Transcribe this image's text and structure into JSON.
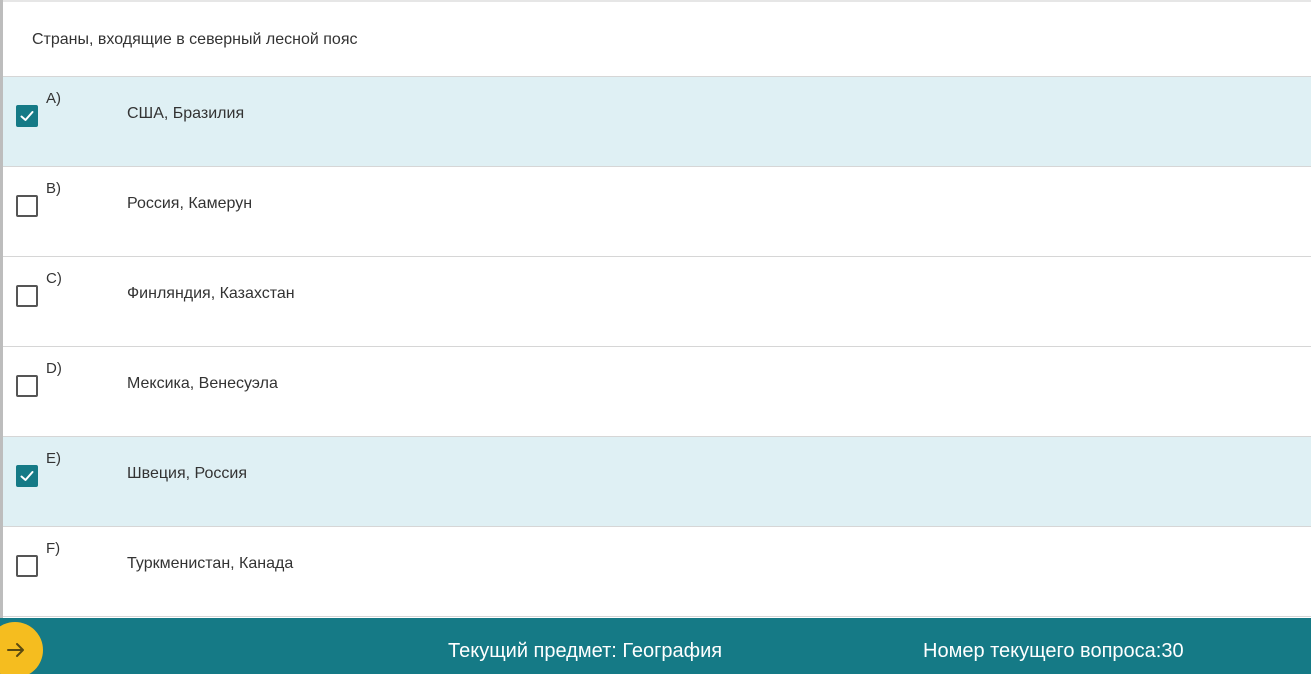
{
  "question": {
    "text": "Страны, входящие в северный лесной пояс"
  },
  "answers": [
    {
      "letter": "A)",
      "text": "США, Бразилия",
      "checked": true
    },
    {
      "letter": "B)",
      "text": "Россия, Камерун",
      "checked": false
    },
    {
      "letter": "C)",
      "text": "Финляндия, Казахстан",
      "checked": false
    },
    {
      "letter": "D)",
      "text": "Мексика, Венесуэла",
      "checked": false
    },
    {
      "letter": "E)",
      "text": "Швеция, Россия",
      "checked": true
    },
    {
      "letter": "F)",
      "text": "Туркменистан, Канада",
      "checked": false
    }
  ],
  "footer": {
    "subject": "Текущий предмет: География",
    "question_number": "Номер текущего вопроса:30",
    "next_icon": "arrow-right-icon"
  },
  "colors": {
    "accent": "#157a86",
    "selected_row": "#dff0f4",
    "next_button": "#f5bd1f"
  }
}
